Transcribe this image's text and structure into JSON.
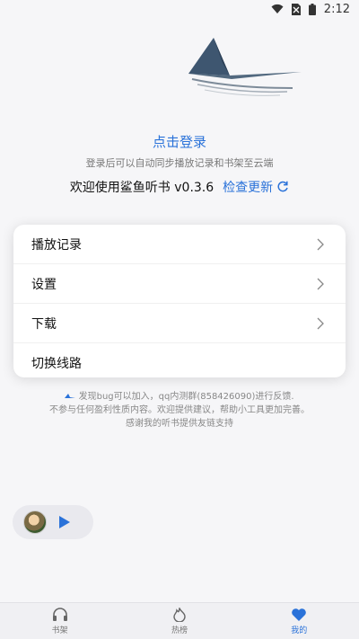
{
  "status_bar": {
    "time": "2:12",
    "icons": [
      "wifi-icon",
      "no-sim-icon",
      "battery-icon"
    ]
  },
  "profile": {
    "login_label": "点击登录",
    "login_hint": "登录后可以自动同步播放记录和书架至云端",
    "welcome": "欢迎使用鲨鱼听书 v0.3.6",
    "check_update": "检查更新"
  },
  "menu": [
    {
      "label": "播放记录",
      "has_arrow": true
    },
    {
      "label": "设置",
      "has_arrow": true
    },
    {
      "label": "下载",
      "has_arrow": true
    },
    {
      "label": "切换线路",
      "has_arrow": false
    }
  ],
  "feedback": {
    "line1": "发现bug可以加入，qq内测群(858426090)进行反馈.",
    "line2": "不参与任何盈利性质内容。欢迎提供建议，帮助小工具更加完善。",
    "line3": "感谢我的听书提供友链支持"
  },
  "bottom_nav": [
    {
      "label": "书架",
      "icon": "headphones-icon"
    },
    {
      "label": "热榜",
      "icon": "flame-icon"
    },
    {
      "label": "我的",
      "icon": "heart-icon",
      "active": true
    }
  ],
  "colors": {
    "accent": "#2a72d9",
    "background": "#f6f6f8"
  }
}
